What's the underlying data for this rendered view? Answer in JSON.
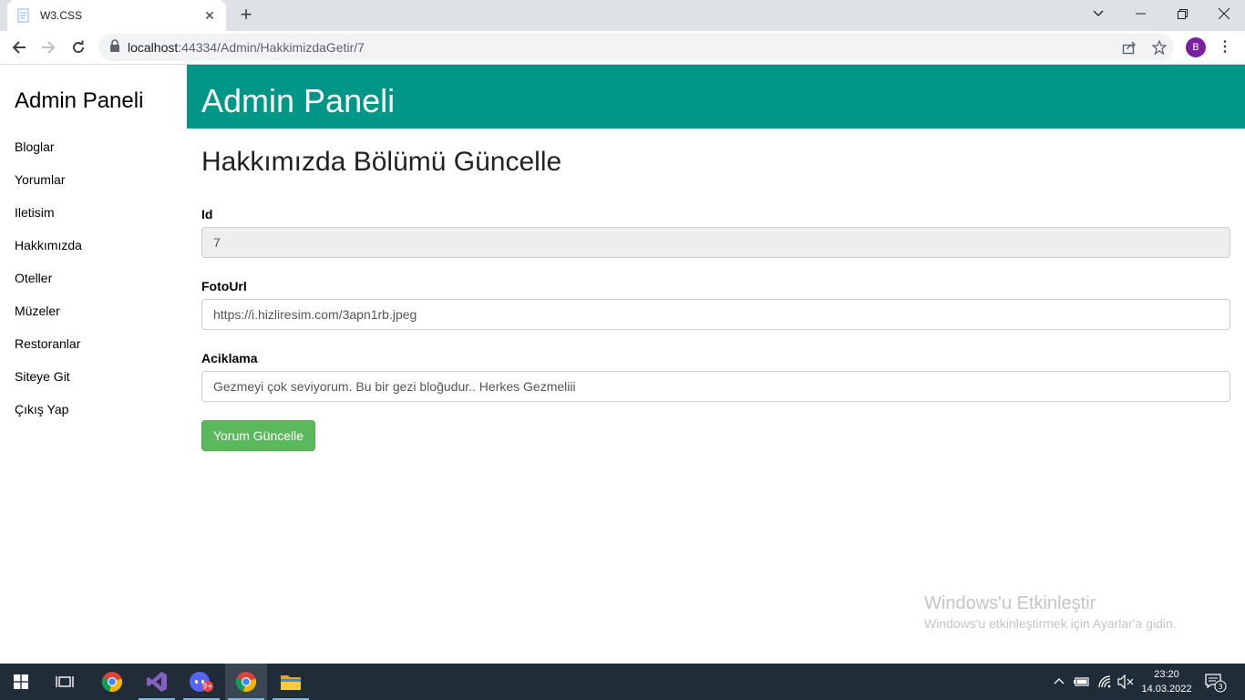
{
  "browser": {
    "tab_title": "W3.CSS",
    "url_host": "localhost",
    "url_path": ":44334/Admin/HakkimizdaGetir/7",
    "profile_initial": "B"
  },
  "sidebar": {
    "title": "Admin Paneli",
    "items": [
      {
        "label": "Bloglar"
      },
      {
        "label": "Yorumlar"
      },
      {
        "label": "Iletisim"
      },
      {
        "label": "Hakkımızda"
      },
      {
        "label": "Oteller"
      },
      {
        "label": "Müzeler"
      },
      {
        "label": "Restoranlar"
      },
      {
        "label": "Siteye Git"
      },
      {
        "label": "Çıkış Yap"
      }
    ]
  },
  "header": {
    "title": "Admin Paneli"
  },
  "main": {
    "section_title": "Hakkımızda Bölümü Güncelle",
    "fields": {
      "id": {
        "label": "Id",
        "value": "7"
      },
      "foto_url": {
        "label": "FotoUrl",
        "value": "https://i.hizliresim.com/3apn1rb.jpeg"
      },
      "aciklama": {
        "label": "Aciklama",
        "value": "Gezmeyi çok seviyorum. Bu bir gezi bloğudur.. Herkes Gezmeliii"
      }
    },
    "submit_label": "Yorum Güncelle"
  },
  "watermark": {
    "title": "Windows'u Etkinleştir",
    "subtitle": "Windows'u etkinleştirmek için Ayarlar'a gidin."
  },
  "taskbar": {
    "time": "23:20",
    "date": "14.03.2022",
    "notification_count": "3",
    "discord_badge": "9+"
  },
  "colors": {
    "header_teal": "#009688",
    "button_green": "#5cb85c",
    "taskbar": "#202c38"
  }
}
